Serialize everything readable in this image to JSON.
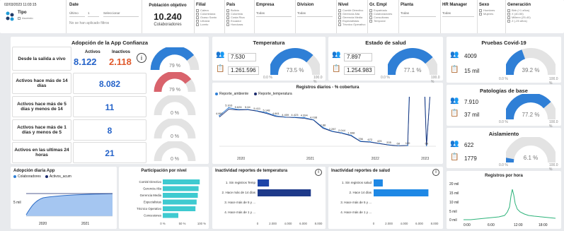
{
  "filters": {
    "datetime": "02/03/2023 11:03:15",
    "tipo": {
      "label": "Tipo",
      "option": "Ascendo"
    },
    "fecha": {
      "label": "Date",
      "mode": "Último",
      "count": "1",
      "unit": "Seleccionar",
      "note": "No se han aplicado filtros"
    },
    "poblacion": {
      "label": "Población objetivo",
      "value": "10.240",
      "sub": "Colaboradores"
    },
    "filial": {
      "label": "Filial",
      "options": [
        "Calera",
        "Colombiana",
        "Ocaso Santo",
        "Urbaná",
        "Loreto"
      ]
    },
    "pais": {
      "label": "País",
      "options": [
        "Bolivia",
        "Colombia",
        "Costa Rica",
        "Ecuador",
        "Honduras"
      ]
    },
    "empresa": {
      "label": "Empresa",
      "value": "Todas"
    },
    "division": {
      "label": "Division",
      "value": "Todas"
    },
    "nivel": {
      "label": "Nivel",
      "options": [
        "Comité Directivo",
        "Gerencia Alta",
        "Gerencia Media",
        "Especialistas",
        "Técnico Operativo"
      ]
    },
    "grempl": {
      "label": "Gr. Empl",
      "options": [
        "Expatriado",
        "Colaboradores",
        "Consultoras",
        "Temporal"
      ]
    },
    "planta": {
      "label": "Planta",
      "value": "Todas"
    },
    "hrmanager": {
      "label": "HR Manager",
      "value": "Todas"
    },
    "sexo": {
      "label": "Sexo",
      "options": [
        "Hombres",
        "Mujeres"
      ]
    },
    "generacion": {
      "label": "Generación",
      "options": [
        "Bbb (+1 años)",
        "X (40-55)",
        "Millenn (25-40)",
        "Z (-25 años)"
      ]
    }
  },
  "adopcion": {
    "title": "Adopción de la App Confianza",
    "rows": [
      {
        "label": "Desde la salida a vivo",
        "activos_label": "Activos",
        "inactivos_label": "Inactivos",
        "activos": "8.122",
        "inactivos": "2.118",
        "gauge": "79 %"
      },
      {
        "label": "Activos hace más de 14 días",
        "value": "8.082",
        "gauge": "79 %"
      },
      {
        "label": "Activos hace más de 5 días y menos de 14",
        "value": "11",
        "gauge": "0 %"
      },
      {
        "label": "Activos hace más de 1 días y menos de 5",
        "value": "8",
        "gauge": "0 %"
      },
      {
        "label": "Activos en las ultimas 24 horas",
        "value": "21",
        "gauge": "0 %"
      }
    ]
  },
  "temperatura": {
    "title": "Temperatura",
    "people": "7.530",
    "docs": "1.261.596",
    "pct": "73.5 %",
    "min": "0.0 %",
    "max": "100.0 %"
  },
  "salud": {
    "title": "Estado de salud",
    "people": "7.897",
    "docs": "1.254.983",
    "pct": "77.1 %",
    "min": "0.0 %",
    "max": "100.0 %"
  },
  "registros": {
    "title": "Registros diarios - % cobertura",
    "legend": [
      "Reporte_ambiente",
      "Reporte_temperatura"
    ],
    "years": [
      "2020",
      "2021",
      "2022",
      "2023"
    ]
  },
  "covid": {
    "title": "Pruebas Covid-19",
    "people": "4009",
    "docs": "15 mil",
    "pct": "39.2 %",
    "min": "0.0 %",
    "max": "100.0 %"
  },
  "patologias": {
    "title": "Patologías de base",
    "people": "7.910",
    "docs": "37 mil",
    "pct": "77.2 %",
    "min": "0.0 %",
    "max": "100.0 %"
  },
  "aislamiento": {
    "title": "Aislamiento",
    "people": "622",
    "docs": "1779",
    "pct": "6.1 %",
    "min": "0.0 %",
    "max": "100.0 %"
  },
  "adopcion_diaria": {
    "title": "Adopción diaria App",
    "legend": [
      "Colaboradores",
      "Activos_acum"
    ],
    "ytick": "5 mil",
    "years": [
      "2020",
      "2021"
    ]
  },
  "participacion": {
    "title": "Participación por nivel",
    "levels": [
      "Comité Directivo",
      "Gerencia Alta",
      "Gerencia Media",
      "Especialistas",
      "Técnico Operativo",
      "Concesiones"
    ],
    "values": [
      95,
      92,
      90,
      87,
      84,
      40
    ],
    "ticks": [
      "0 %",
      "50 %",
      "100 %"
    ]
  },
  "inact_temp": {
    "title": "Inactividad reportes de temperatura",
    "labels": [
      "1. Sin registros Temp",
      "2. Hace más de 14 días",
      "3. Hace más de 5 y ...",
      "4. Hace más de 1 y ..."
    ],
    "values": [
      1500,
      7000,
      0,
      0
    ],
    "ticks": [
      "0",
      "2.000",
      "4.000",
      "6.000",
      "8.000"
    ]
  },
  "inact_salud": {
    "title": "Inactividad reportes de salud",
    "labels": [
      "1. Sin registros salud",
      "2. Hace 14 días",
      "3. Hace más de 5 y ...",
      "4. Hace más de 1 y ..."
    ],
    "values": [
      1200,
      7200,
      0,
      0
    ],
    "ticks": [
      "0",
      "2.000",
      "4.000",
      "6.000",
      "8.000"
    ]
  },
  "registros_hora": {
    "title": "Registros por hora",
    "yticks": [
      "20 mil",
      "15 mil",
      "10 mil",
      "5 mil",
      "0 mil"
    ],
    "xticks": [
      "0:00",
      "6:00",
      "12:00",
      "18:00"
    ]
  },
  "chart_data": {
    "type": "line",
    "title": "Registros diarios - % cobertura",
    "series": [
      {
        "name": "Reporte_ambiente",
        "values": [
          4.667,
          5.916,
          5.626,
          5.64,
          5.411,
          5.148,
          4.661,
          4.459,
          4.423,
          4.394,
          4.038,
          2.88,
          2.287,
          2.044,
          1.668,
          756,
          672,
          425,
          205,
          68,
          120,
          46,
          68,
          21
        ]
      },
      {
        "name": "Reporte_temperatura",
        "values": [
          4.467,
          5.678,
          5.56,
          5.615,
          5.383,
          5.029,
          4.564,
          4.459,
          4.39,
          4.275,
          4.005,
          2.76,
          2.247,
          1.99,
          1.6,
          700,
          627,
          399,
          180,
          60,
          110,
          40,
          60,
          21
        ]
      }
    ]
  }
}
